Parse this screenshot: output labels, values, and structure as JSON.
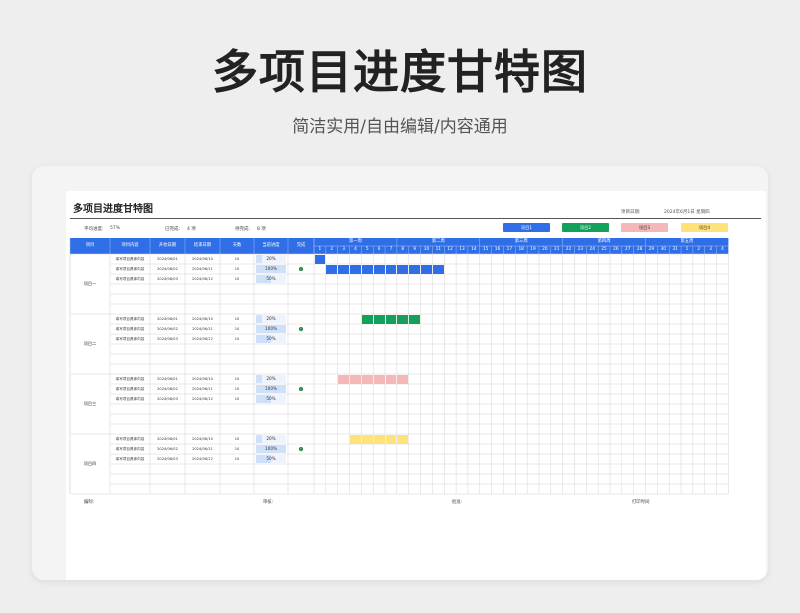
{
  "hero": {
    "title": "多项目进度甘特图",
    "subtitle": "简洁实用/自由编辑/内容通用"
  },
  "sheet": {
    "title": "多项目进度甘特图",
    "meta": {
      "date_label": "项目日期:",
      "date_value": "2024年6月1日 星期四"
    },
    "stats": {
      "avg_label": "平均进度:",
      "avg_value": "57%",
      "done_label": "已完成:",
      "done_value": "4 项",
      "todo_label": "待完成:",
      "todo_value": "8 项"
    },
    "legend": [
      {
        "label": "项目1",
        "color": "#2f6ee6",
        "text": "#fff"
      },
      {
        "label": "项目2",
        "color": "#13a05a",
        "text": "#fff"
      },
      {
        "label": "项目3",
        "color": "#f4b8b8",
        "text": "#333"
      },
      {
        "label": "项目4",
        "color": "#ffe27a",
        "text": "#333"
      }
    ],
    "columns": [
      "项目",
      "项目内容",
      "开始日期",
      "结束日期",
      "天数",
      "当前进度",
      "完成"
    ],
    "weeks": [
      "第一周",
      "第二周",
      "第三周",
      "第四周",
      "第五周"
    ],
    "days": [
      "1",
      "2",
      "3",
      "4",
      "5",
      "6",
      "7",
      "8",
      "9",
      "10",
      "11",
      "12",
      "13",
      "14",
      "15",
      "16",
      "17",
      "18",
      "19",
      "20",
      "21",
      "22",
      "23",
      "24",
      "25",
      "26",
      "27",
      "28",
      "29",
      "30",
      "31",
      "1",
      "2",
      "3",
      "4"
    ],
    "projects": [
      {
        "name": "项目一",
        "color": "#2f6ee6",
        "tasks": [
          {
            "content": "填写项目具体内容",
            "start": "2024/06/01",
            "end": "2024/06/10",
            "days": "10",
            "progress": 20,
            "progress_label": "20%",
            "done": false,
            "gantt_start": 0,
            "gantt_len": 1
          },
          {
            "content": "填写项目具体内容",
            "start": "2024/06/02",
            "end": "2024/06/11",
            "days": "10",
            "progress": 100,
            "progress_label": "100%",
            "done": true,
            "gantt_start": 1,
            "gantt_len": 10
          },
          {
            "content": "填写项目具体内容",
            "start": "2024/06/03",
            "end": "2024/06/12",
            "days": "10",
            "progress": 50,
            "progress_label": "50%",
            "done": false,
            "gantt_start": -1,
            "gantt_len": 0
          }
        ]
      },
      {
        "name": "项目二",
        "color": "#13a05a",
        "tasks": [
          {
            "content": "填写项目具体内容",
            "start": "2024/06/01",
            "end": "2024/06/10",
            "days": "10",
            "progress": 20,
            "progress_label": "20%",
            "done": false,
            "gantt_start": 4,
            "gantt_len": 5
          },
          {
            "content": "填写项目具体内容",
            "start": "2024/06/02",
            "end": "2024/06/11",
            "days": "10",
            "progress": 100,
            "progress_label": "100%",
            "done": true,
            "gantt_start": -1,
            "gantt_len": 0
          },
          {
            "content": "填写项目具体内容",
            "start": "2024/06/03",
            "end": "2024/06/12",
            "days": "10",
            "progress": 50,
            "progress_label": "50%",
            "done": false,
            "gantt_start": -1,
            "gantt_len": 0
          }
        ]
      },
      {
        "name": "项目三",
        "color": "#f4b8b8",
        "tasks": [
          {
            "content": "填写项目具体内容",
            "start": "2024/06/01",
            "end": "2024/06/10",
            "days": "10",
            "progress": 20,
            "progress_label": "20%",
            "done": false,
            "gantt_start": 2,
            "gantt_len": 6
          },
          {
            "content": "填写项目具体内容",
            "start": "2024/06/02",
            "end": "2024/06/11",
            "days": "10",
            "progress": 100,
            "progress_label": "100%",
            "done": true,
            "gantt_start": -1,
            "gantt_len": 0
          },
          {
            "content": "填写项目具体内容",
            "start": "2024/06/03",
            "end": "2024/06/12",
            "days": "10",
            "progress": 50,
            "progress_label": "50%",
            "done": false,
            "gantt_start": -1,
            "gantt_len": 0
          }
        ]
      },
      {
        "name": "项目四",
        "color": "#ffe27a",
        "tasks": [
          {
            "content": "填写项目具体内容",
            "start": "2024/06/01",
            "end": "2024/06/10",
            "days": "10",
            "progress": 20,
            "progress_label": "20%",
            "done": false,
            "gantt_start": 3,
            "gantt_len": 5
          },
          {
            "content": "填写项目具体内容",
            "start": "2024/06/02",
            "end": "2024/06/11",
            "days": "10",
            "progress": 100,
            "progress_label": "100%",
            "done": true,
            "gantt_start": -1,
            "gantt_len": 0
          },
          {
            "content": "填写项目具体内容",
            "start": "2024/06/03",
            "end": "2024/06/12",
            "days": "10",
            "progress": 50,
            "progress_label": "50%",
            "done": false,
            "gantt_start": -1,
            "gantt_len": 0
          }
        ]
      }
    ],
    "footer": {
      "author": "编制:",
      "reviewer": "审核:",
      "approver": "批准:",
      "print_date": "打印时间:"
    },
    "colors": {
      "header": "#2f6ee6",
      "header_line": "#9fbff5",
      "grid": "#d4d4d4",
      "progress_fill": "#cfe0fb",
      "progress_empty": "#eef3fc"
    }
  }
}
